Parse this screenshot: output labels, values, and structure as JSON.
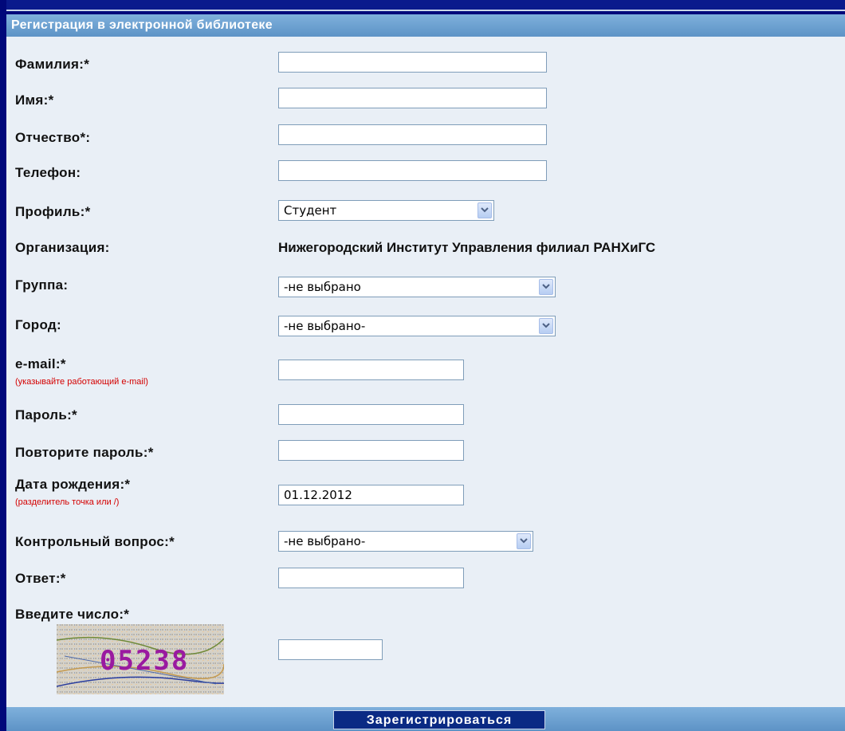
{
  "form": {
    "title": "Регистрация в электронной библиотеке",
    "fields": {
      "lastname": "Фамилия:*",
      "firstname": "Имя:*",
      "patronymic": "Отчество*:",
      "phone": "Телефон:",
      "profile": "Профиль:*",
      "organization": "Организация:",
      "group": "Группа:",
      "city": "Город:",
      "email": "e-mail:*",
      "email_hint": "(указывайте работающий e-mail)",
      "password": "Пароль:*",
      "password_repeat": "Повторите пароль:*",
      "birthdate": "Дата рождения:*",
      "birthdate_hint": "(разделитель точка или /)",
      "question": "Контрольный вопрос:*",
      "answer": "Ответ:*",
      "captcha": "Введите число:*"
    },
    "values": {
      "profile": "Студент",
      "organization": "Нижегородский Институт Управления филиал РАНХиГС",
      "group": "-не выбрано",
      "city": "-не выбрано-",
      "birthdate": "01.12.2012",
      "question": "-не выбрано-"
    },
    "captcha_code": "05238",
    "submit_label": "Зарегистрироваться"
  }
}
